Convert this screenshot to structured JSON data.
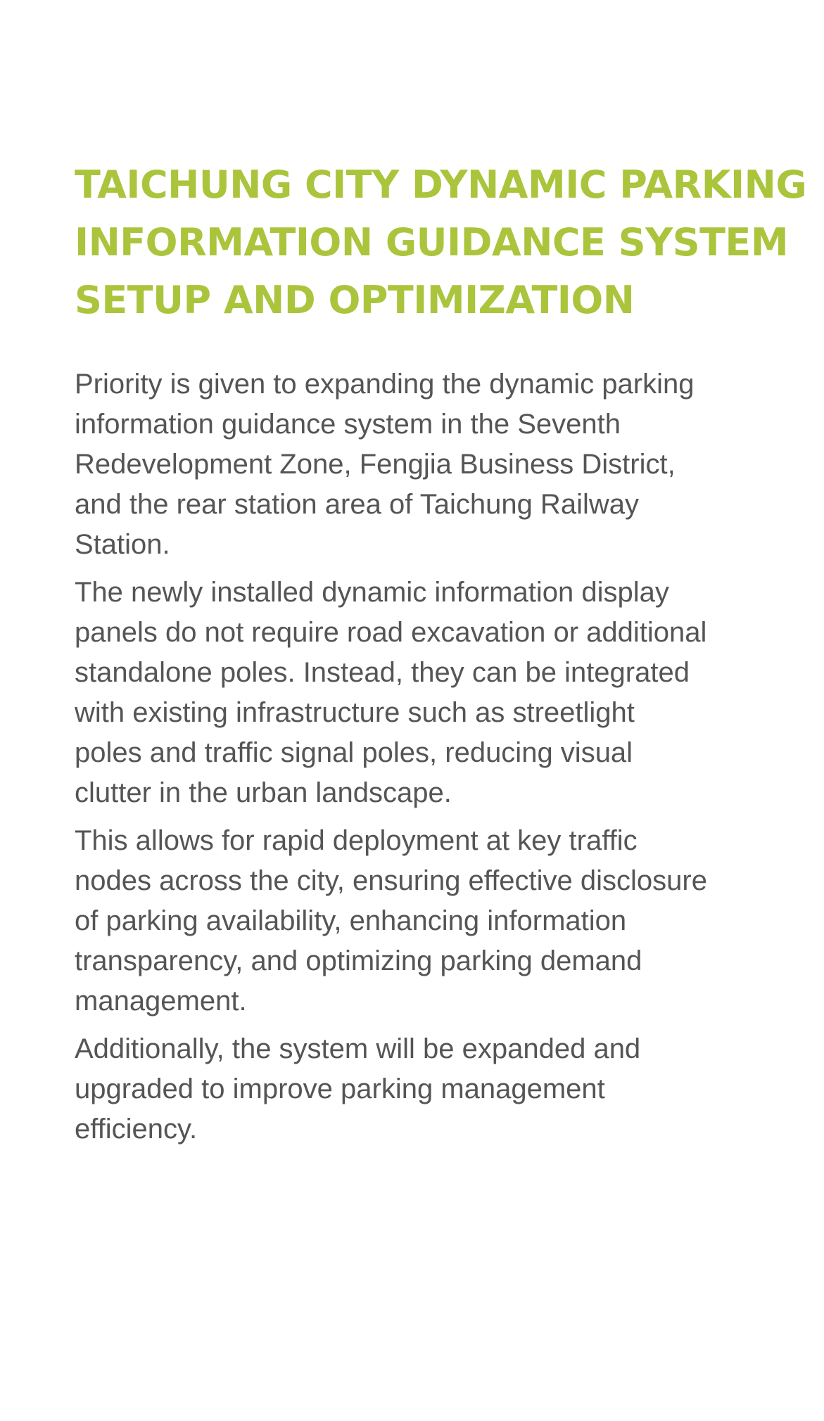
{
  "title_lines": [
    "TAICHUNG CITY DYNAMIC PARKING",
    "INFORMATION GUIDANCE SYSTEM",
    "SETUP AND OPTIMIZATION"
  ],
  "paragraphs": [
    [
      "Priority is given to expanding the dynamic parking",
      "information guidance system in the Seventh",
      "Redevelopment Zone, Fengjia Business District,",
      "and the rear station area of Taichung Railway",
      "Station."
    ],
    [
      "The newly installed dynamic information display",
      "panels do not require road excavation or additional",
      "standalone poles. Instead, they can be integrated",
      "with existing infrastructure such as streetlight",
      "poles and traffic signal poles, reducing visual",
      "clutter in the urban landscape."
    ],
    [
      "This allows for rapid deployment at key traffic",
      "nodes across the city, ensuring effective disclosure",
      "of parking availability, enhancing information",
      "transparency, and optimizing parking demand",
      "management."
    ],
    [
      "Additionally, the system will be expanded and",
      "upgraded to improve parking management",
      "efficiency."
    ]
  ],
  "colors": {
    "title": "#aac43c",
    "body_text": "#555555",
    "background": "#ffffff"
  }
}
